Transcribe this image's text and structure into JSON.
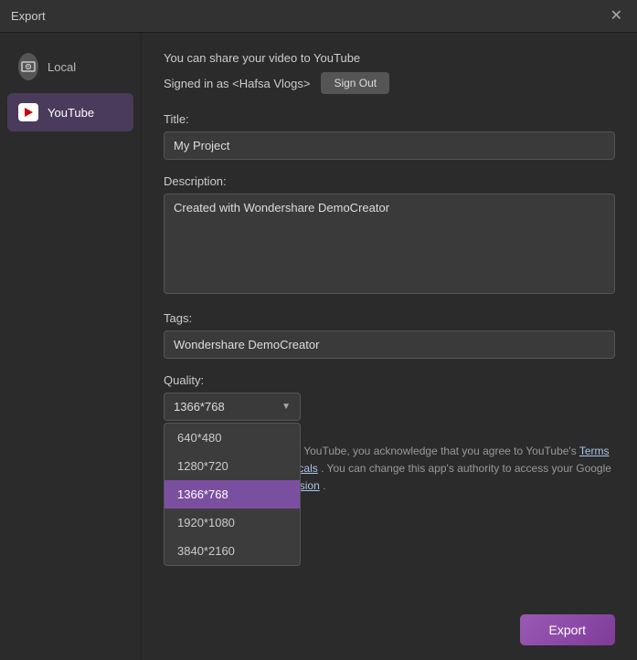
{
  "window": {
    "title": "Export",
    "close_label": "✕"
  },
  "sidebar": {
    "items": [
      {
        "id": "local",
        "label": "Local",
        "icon": "local-icon",
        "active": false
      },
      {
        "id": "youtube",
        "label": "YouTube",
        "icon": "youtube-icon",
        "active": true
      }
    ]
  },
  "content": {
    "share_text": "You can share your video to YouTube",
    "signed_in_label": "Signed in as <Hafsa Vlogs>",
    "sign_out_label": "Sign Out",
    "title_label": "Title:",
    "title_value": "My Project",
    "title_placeholder": "My Project",
    "description_label": "Description:",
    "description_value": "Created with Wondershare DemoCreator",
    "tags_label": "Tags:",
    "tags_value": "Wondershare DemoCreator",
    "quality_label": "Quality:",
    "quality_selected": "1366*768",
    "quality_options": [
      {
        "value": "640*480",
        "label": "640*480",
        "selected": false
      },
      {
        "value": "1280*720",
        "label": "1280*720",
        "selected": false
      },
      {
        "value": "1366*768",
        "label": "1366*768",
        "selected": true
      },
      {
        "value": "1920*1080",
        "label": "1920*1080",
        "selected": false
      },
      {
        "value": "3840*2160",
        "label": "3840*2160",
        "selected": false
      }
    ],
    "footer_text_before": "By submitting your videos to YouTube, you acknowledge that you agree to YouTube's ",
    "footer_link1": "Terms of Service",
    "footer_text_mid1": " and ",
    "footer_link2": "Privacy politicals",
    "footer_text_mid2": " . You can change this app's authority to access your Google Account via ",
    "footer_link3": "Account Permission",
    "footer_text_end": " .",
    "export_label": "Export"
  }
}
